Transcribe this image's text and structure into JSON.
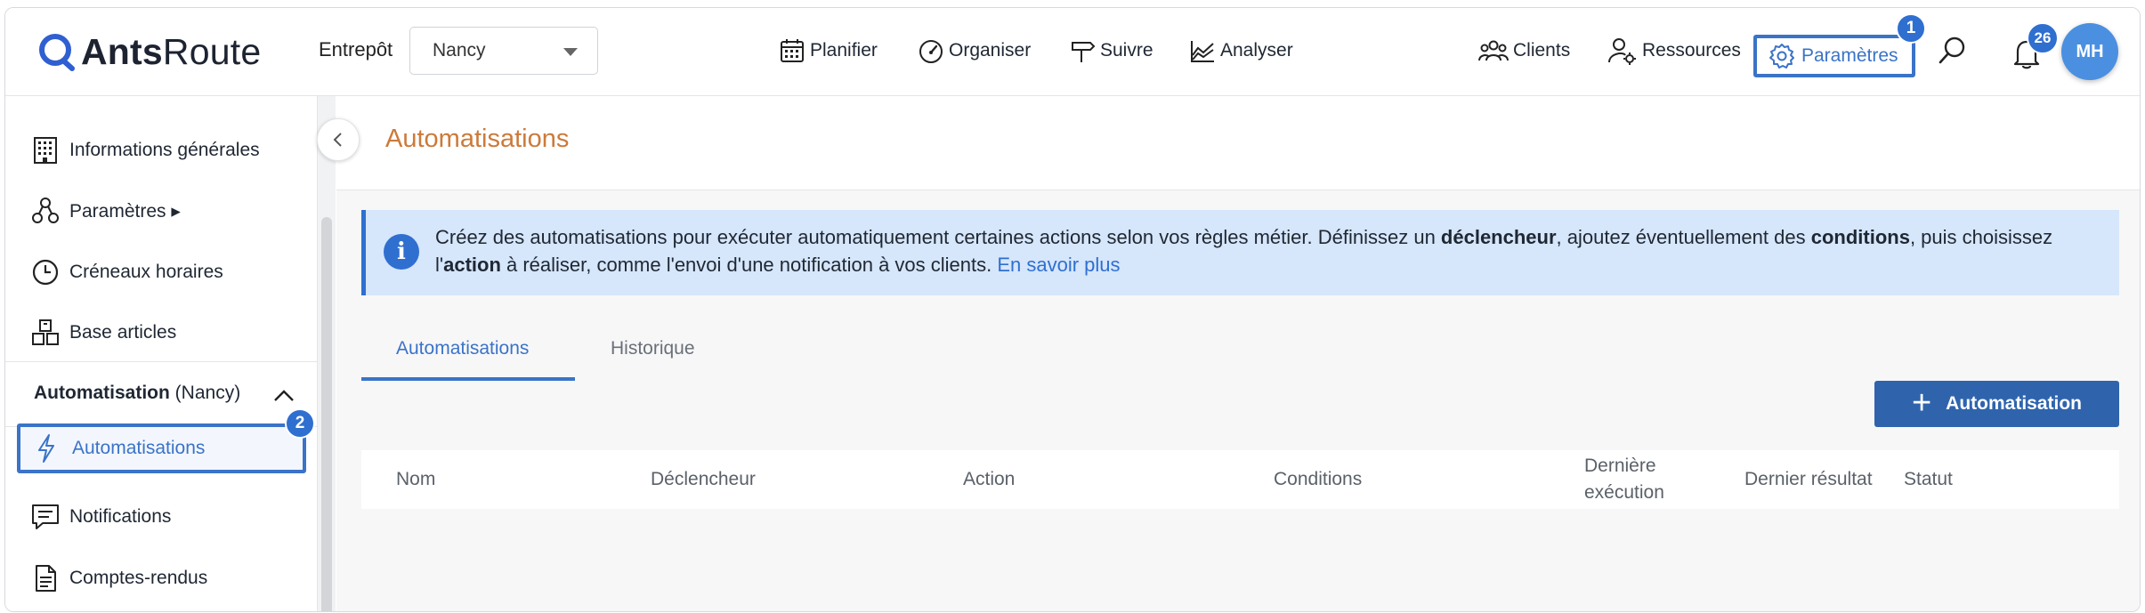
{
  "app": {
    "logo_bold": "Ants",
    "logo_light": "Route",
    "warehouse_label": "Entrepôt",
    "warehouse_value": "Nancy"
  },
  "nav": {
    "plan": "Planifier",
    "organize": "Organiser",
    "track": "Suivre",
    "analyze": "Analyser",
    "clients": "Clients",
    "resources": "Ressources",
    "settings": "Paramètres",
    "settings_badge": "1",
    "notifications_count": "26",
    "avatar_initials": "MH"
  },
  "sidebar": {
    "items": [
      {
        "label": "Informations générales"
      },
      {
        "label": "Paramètres ▸"
      },
      {
        "label": "Créneaux horaires"
      },
      {
        "label": "Base articles"
      }
    ],
    "section_title_bold": "Automatisation",
    "section_title_rest": " (Nancy)",
    "active_item": "Automatisations",
    "active_badge": "2",
    "items_after": [
      {
        "label": "Notifications"
      },
      {
        "label": "Comptes-rendus"
      }
    ]
  },
  "main": {
    "title": "Automatisations",
    "info": {
      "t1": "Créez des automatisations pour exécuter automatiquement certaines actions selon vos règles métier. Définissez un ",
      "b1": "déclencheur",
      "t2": ", ajoutez éventuellement des ",
      "b2": "conditions",
      "t3": ", puis choisissez l'",
      "b3": "action",
      "t4": " à réaliser, comme l'envoi d'une notification à vos clients. ",
      "link": "En savoir plus"
    },
    "tabs": [
      {
        "label": "Automatisations",
        "active": true
      },
      {
        "label": "Historique",
        "active": false
      }
    ],
    "add_button": "Automatisation",
    "columns": [
      "Nom",
      "Déclencheur",
      "Action",
      "Conditions",
      "Dernière",
      "exécution",
      "Dernier résultat",
      "Statut"
    ]
  },
  "colors": {
    "accent": "#3a73c8",
    "title": "#cc7a3a",
    "info_bg": "#d6e6fb",
    "button": "#2f64ad"
  }
}
